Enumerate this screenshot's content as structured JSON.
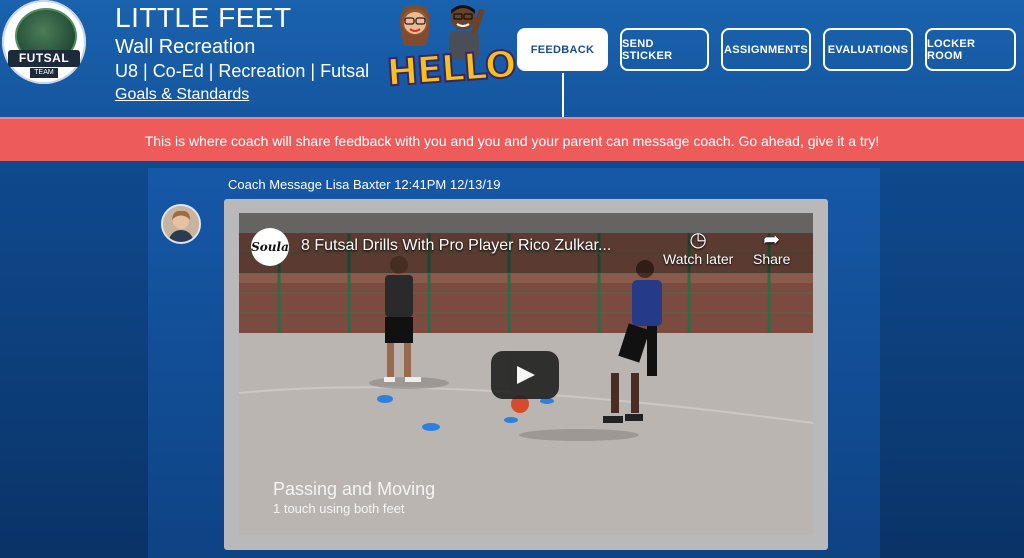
{
  "header": {
    "team_name": "LITTLE FEET",
    "league": "Wall Recreation",
    "meta": "U8 | Co-Ed | Recreation | Futsal",
    "goals_link": "Goals & Standards",
    "logo": {
      "banner": "FUTSAL",
      "sub": "TEAM"
    },
    "hello_text": "HELLO"
  },
  "nav": {
    "feedback": "FEEDBACK",
    "send_sticker": "SEND STICKER",
    "assignments": "ASSIGNMENTS",
    "evaluations": "EVALUATIONS",
    "locker_room": "LOCKER ROOM"
  },
  "banner": {
    "text": "This is where coach will share feedback with you and you and your parent can message coach. Go ahead, give it a try!"
  },
  "message": {
    "header": "Coach Message Lisa Baxter 12:41PM 12/13/19"
  },
  "video": {
    "channel": "Soula",
    "title": "8 Futsal Drills With Pro Player Rico Zulkar...",
    "watch_later": "Watch later",
    "share": "Share",
    "caption_title": "Passing and Moving",
    "caption_sub": "1 touch using both feet"
  },
  "colors": {
    "header_bg": "#1a62ad",
    "banner_bg": "#ee5b5b",
    "page_bg": "#0c3e7a"
  }
}
